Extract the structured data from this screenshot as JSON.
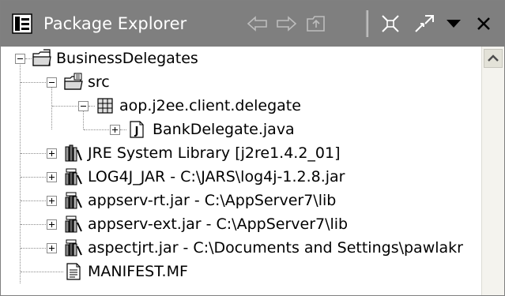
{
  "view": {
    "title": "Package Explorer",
    "icon": "package-explorer-icon",
    "toolbar": [
      {
        "name": "back-icon",
        "glyph": "⇦"
      },
      {
        "name": "forward-icon",
        "glyph": "⇨"
      },
      {
        "name": "up-icon"
      },
      {
        "name": "collapse-all-icon"
      },
      {
        "name": "link-with-editor-icon"
      },
      {
        "name": "view-menu-icon",
        "glyph": "▼"
      },
      {
        "name": "close-icon",
        "glyph": "×"
      }
    ]
  },
  "tree": {
    "items": [
      {
        "label": "BusinessDelegates",
        "icon": "project-folder-icon",
        "depth": 0,
        "toggle": "minus"
      },
      {
        "label": "src",
        "icon": "source-folder-icon",
        "depth": 1,
        "toggle": "minus"
      },
      {
        "label": "aop.j2ee.client.delegate",
        "icon": "package-icon",
        "depth": 2,
        "toggle": "minus"
      },
      {
        "label": "BankDelegate.java",
        "icon": "java-file-icon",
        "depth": 3,
        "toggle": "plus"
      },
      {
        "label": "JRE System Library [j2re1.4.2_01]",
        "icon": "library-icon",
        "depth": 1,
        "toggle": "plus"
      },
      {
        "label": "LOG4J_JAR - C:\\JARS\\log4j-1.2.8.jar",
        "icon": "jar-icon",
        "depth": 1,
        "toggle": "plus"
      },
      {
        "label": "appserv-rt.jar - C:\\AppServer7\\lib",
        "icon": "jar-icon",
        "depth": 1,
        "toggle": "plus"
      },
      {
        "label": "appserv-ext.jar - C:\\AppServer7\\lib",
        "icon": "jar-icon",
        "depth": 1,
        "toggle": "plus"
      },
      {
        "label": "aspectjrt.jar - C:\\Documents and Settings\\pawlakr",
        "icon": "jar-icon",
        "depth": 1,
        "toggle": "plus"
      },
      {
        "label": "MANIFEST.MF",
        "icon": "text-file-icon",
        "depth": 1,
        "toggle": "none"
      }
    ]
  },
  "colors": {
    "titlebar": "#7f7f7f",
    "title_text": "#ffffff",
    "background": "#ffffff"
  }
}
